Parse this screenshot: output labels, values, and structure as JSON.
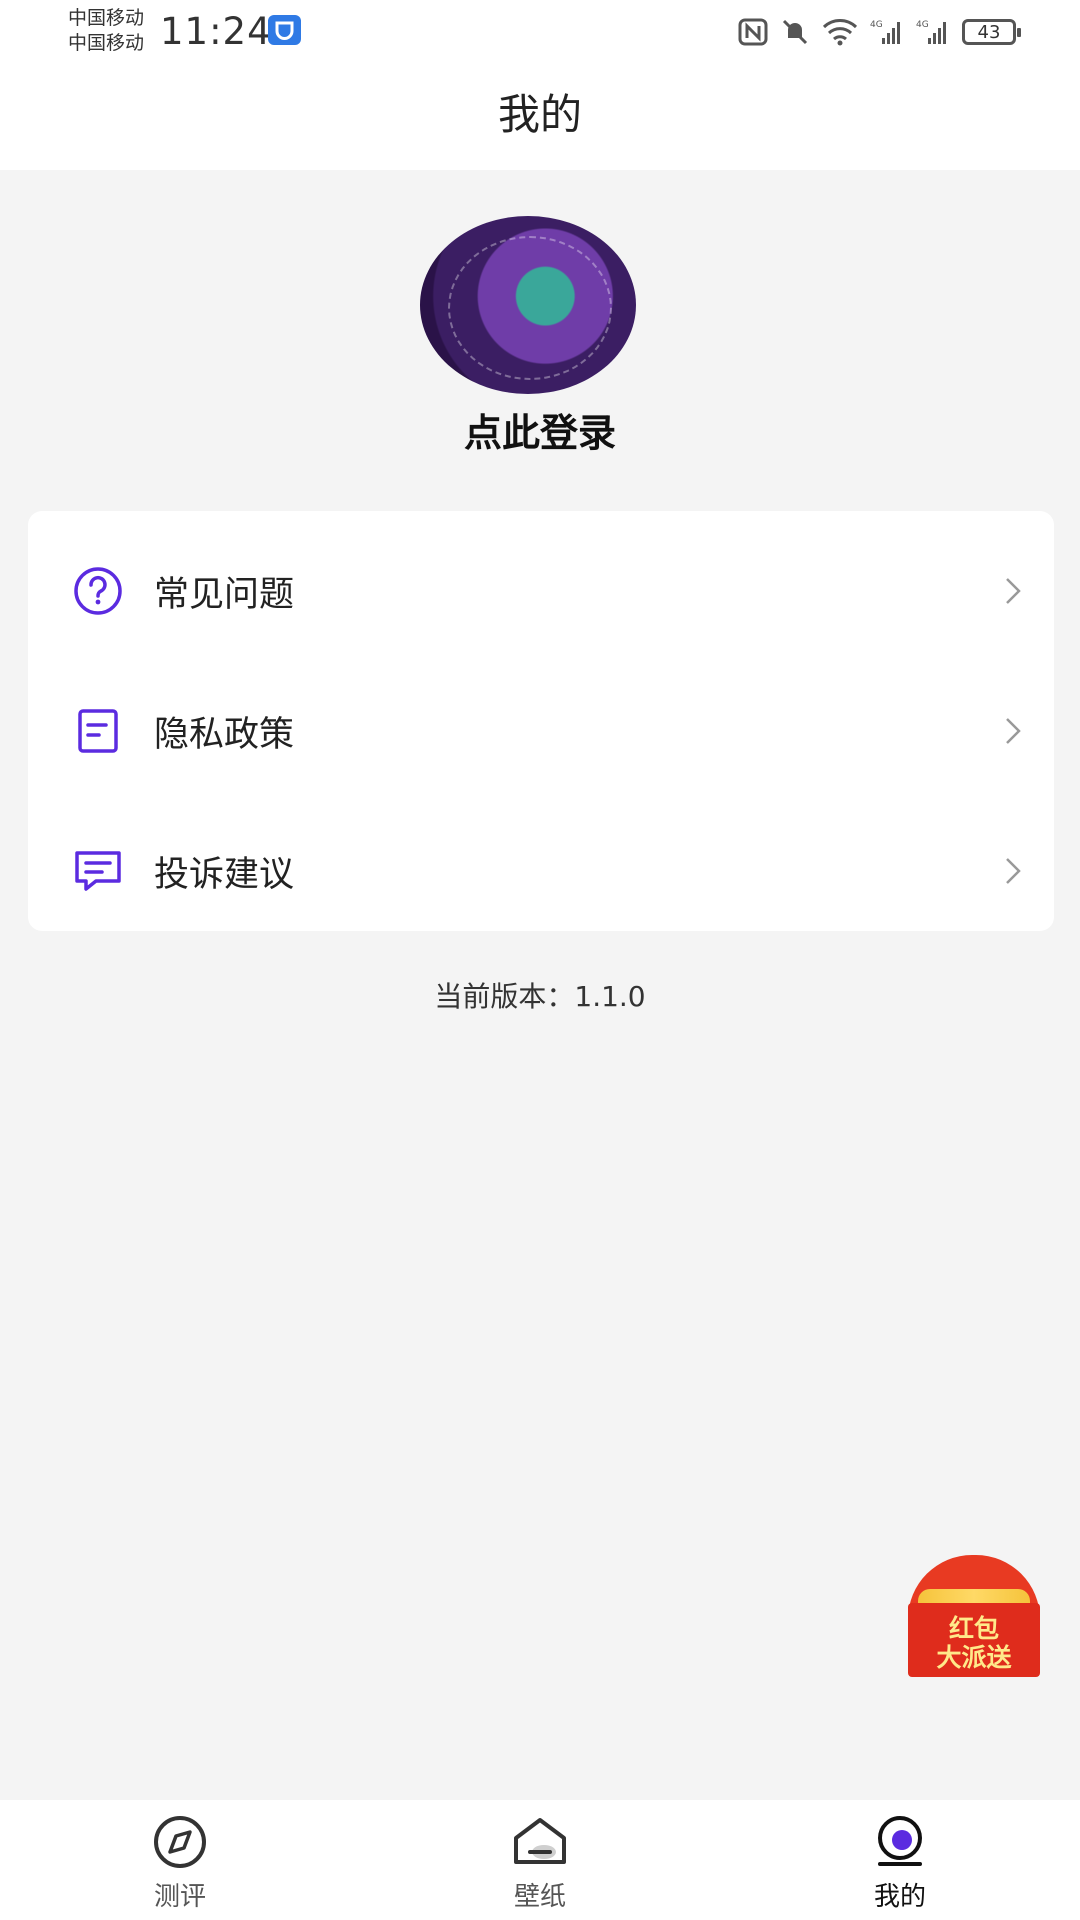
{
  "status_bar": {
    "carrier_1": "中国移动",
    "carrier_2": "中国移动",
    "time": "11:24",
    "battery": "43"
  },
  "header": {
    "title": "我的"
  },
  "profile": {
    "login_label": "点此登录"
  },
  "menu": {
    "items": [
      {
        "label": "常见问题",
        "icon": "question-circle-icon"
      },
      {
        "label": "隐私政策",
        "icon": "document-icon"
      },
      {
        "label": "投诉建议",
        "icon": "chat-message-icon"
      }
    ]
  },
  "version_text": "当前版本：1.1.0",
  "promo": {
    "line_1": "红包",
    "line_2": "大派送"
  },
  "tabbar": {
    "tabs": [
      {
        "label": "测评",
        "icon": "compass-icon",
        "active": false
      },
      {
        "label": "壁纸",
        "icon": "wallpaper-home-icon",
        "active": false
      },
      {
        "label": "我的",
        "icon": "profile-icon",
        "active": true
      }
    ]
  },
  "colors": {
    "accent": "#5b2be0",
    "background": "#f4f4f4",
    "card": "#ffffff",
    "promo_red": "#e83a22"
  }
}
